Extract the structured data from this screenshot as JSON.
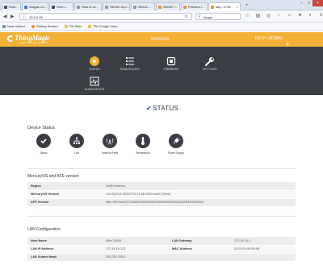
{
  "browser": {
    "tabs": [
      {
        "label": "Kroo..."
      },
      {
        "label": "Sargas Un..."
      },
      {
        "label": "Runn..."
      },
      {
        "label": "How to ra..."
      },
      {
        "label": "SEMIC Apri..."
      },
      {
        "label": "SEMIC -..."
      },
      {
        "label": "SEMIC I..."
      },
      {
        "label": "Problem l..."
      },
      {
        "label": "http...0.05/"
      }
    ],
    "url": "10.0.0.05",
    "search_query": "fargas",
    "bookmarks": [
      "Most Visited",
      "Getting Started",
      "TM Sites",
      "TM Google Sites"
    ]
  },
  "header": {
    "brand": "ThingMagic",
    "tagline": "A DIVISION OF TRIMBLE",
    "site_name": "SARGAS",
    "help_admin": "HELP | ADMIN"
  },
  "nav": [
    {
      "label": "STATUS",
      "icon": "status-icon"
    },
    {
      "label": "READ/PLUGIN",
      "icon": "list-icon"
    },
    {
      "label": "FIRMWARE",
      "icon": "firmware-icon"
    },
    {
      "label": "SETTINGS",
      "icon": "wrench-icon"
    },
    {
      "label": "DIAGNOSTICS",
      "icon": "diagnostics-icon"
    }
  ],
  "page_title": "STATUS",
  "device_status": {
    "title": "Device Status",
    "items": [
      {
        "label": "Status",
        "icon": "check-icon"
      },
      {
        "label": "LAN",
        "icon": "network-icon"
      },
      {
        "label": "Antenna Ports",
        "icon": "antenna-icon"
      },
      {
        "label": "Temperature",
        "icon": "thermometer-icon"
      },
      {
        "label": "Power Supply",
        "icon": "plug-icon"
      }
    ]
  },
  "mercury": {
    "title": "MercuryOS and AFE version",
    "rows": [
      {
        "key": "Region",
        "value": "North America"
      },
      {
        "key": "MercuryOS Version",
        "value": "r.19.3(2014-08/02/T01:11:46-0400 build 2 trunk)"
      },
      {
        "key": "AFE Version",
        "value": "M6e HW/rev0037204002048003260039/d0032040322042/842/4002304"
      }
    ]
  },
  "lan": {
    "title": "LAN Configuration",
    "rows": [
      {
        "key": "Host Name",
        "value": "M6e-25008",
        "key2": "LAN Gateway",
        "value2": "172.16.16.1"
      },
      {
        "key": "LAN IP Address",
        "value": "172.16.16.123",
        "key2": "MAC Address",
        "value2": "02:03:04:05:06:AB"
      },
      {
        "key": "LAN Subnet Mask",
        "value": "255.255.255.0",
        "key2": "",
        "value2": ""
      }
    ]
  }
}
